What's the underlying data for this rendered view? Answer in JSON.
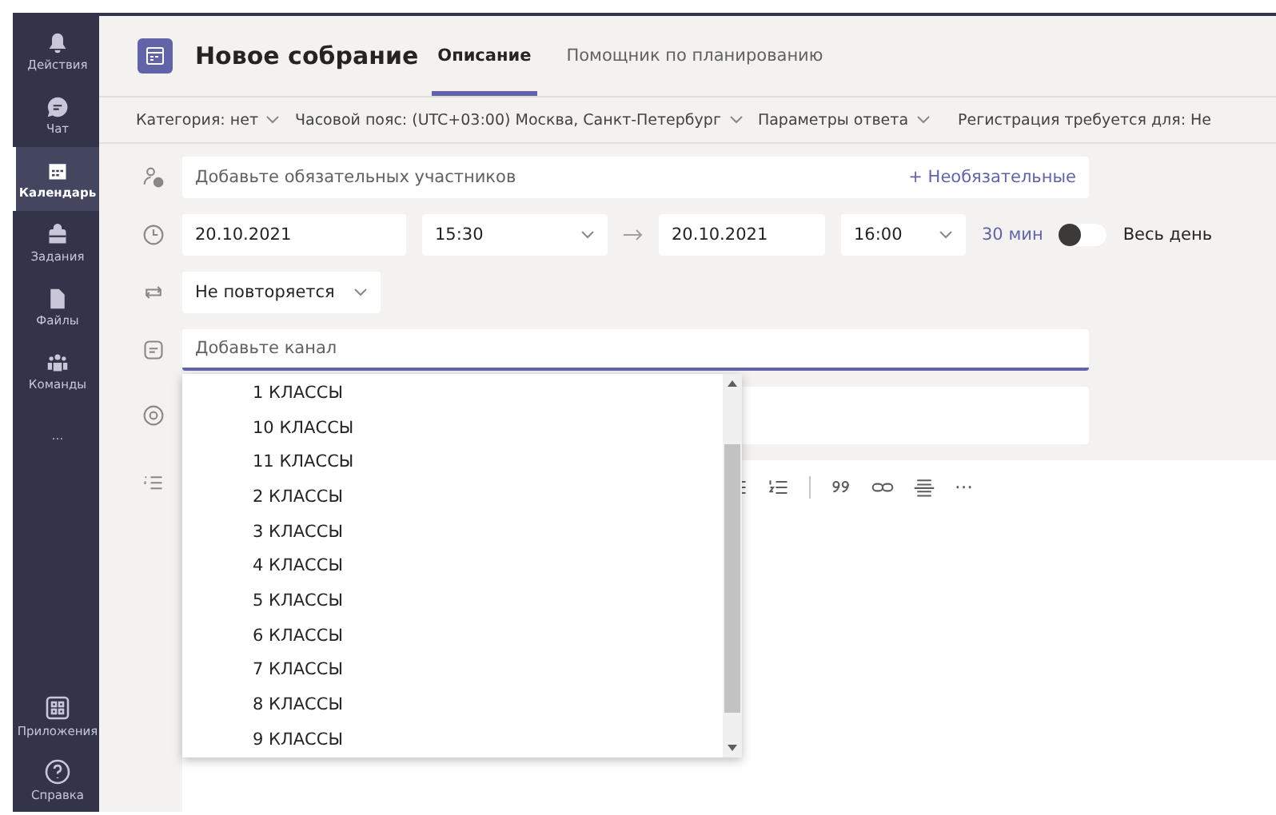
{
  "rail": {
    "items": [
      {
        "label": "Действия",
        "selected": false
      },
      {
        "label": "Чат",
        "selected": false
      },
      {
        "label": "Календарь",
        "selected": true
      },
      {
        "label": "Задания",
        "selected": false
      },
      {
        "label": "Файлы",
        "selected": false
      },
      {
        "label": "Команды",
        "selected": false
      },
      {
        "label": "...",
        "selected": false
      }
    ],
    "bottom": [
      {
        "label": "Приложения"
      },
      {
        "label": "Справка"
      }
    ]
  },
  "header": {
    "title": "Новое собрание",
    "tabs": [
      {
        "label": "Описание",
        "selected": true
      },
      {
        "label": "Помощник по планированию",
        "selected": false
      }
    ]
  },
  "options_bar": [
    {
      "label": "Категория: нет",
      "dropdown": true
    },
    {
      "label": "Часовой пояс: (UTC+03:00) Москва, Санкт-Петербург",
      "dropdown": true
    },
    {
      "label": "Параметры ответа",
      "dropdown": true
    },
    {
      "label": "Регистрация требуется для: Не",
      "dropdown": false
    }
  ],
  "form": {
    "attendees": {
      "placeholder": "Добавьте обязательных участников",
      "optional_link": "+ Необязательные"
    },
    "start_date": "20.10.2021",
    "start_time": "15:30",
    "end_date": "20.10.2021",
    "end_time": "16:00",
    "duration": "30 мин",
    "all_day": {
      "label": "Весь день",
      "on": false
    },
    "repeat": "Не повторяется",
    "channel": {
      "placeholder": "Добавьте канал",
      "focused": true,
      "options": [
        "1 КЛАССЫ",
        "10 КЛАССЫ",
        "11 КЛАССЫ",
        "2 КЛАССЫ",
        "3 КЛАССЫ",
        "4 КЛАССЫ",
        "5 КЛАССЫ",
        "6 КЛАССЫ",
        "7 КЛАССЫ",
        "8 КЛАССЫ",
        "9 КЛАССЫ"
      ]
    },
    "editor_toolbar": [
      {
        "kind": "bullets"
      },
      {
        "kind": "numbers"
      },
      {
        "kind": "divider"
      },
      {
        "kind": "quote"
      },
      {
        "kind": "link"
      },
      {
        "kind": "rule"
      },
      {
        "kind": "text",
        "label": "···"
      }
    ]
  }
}
